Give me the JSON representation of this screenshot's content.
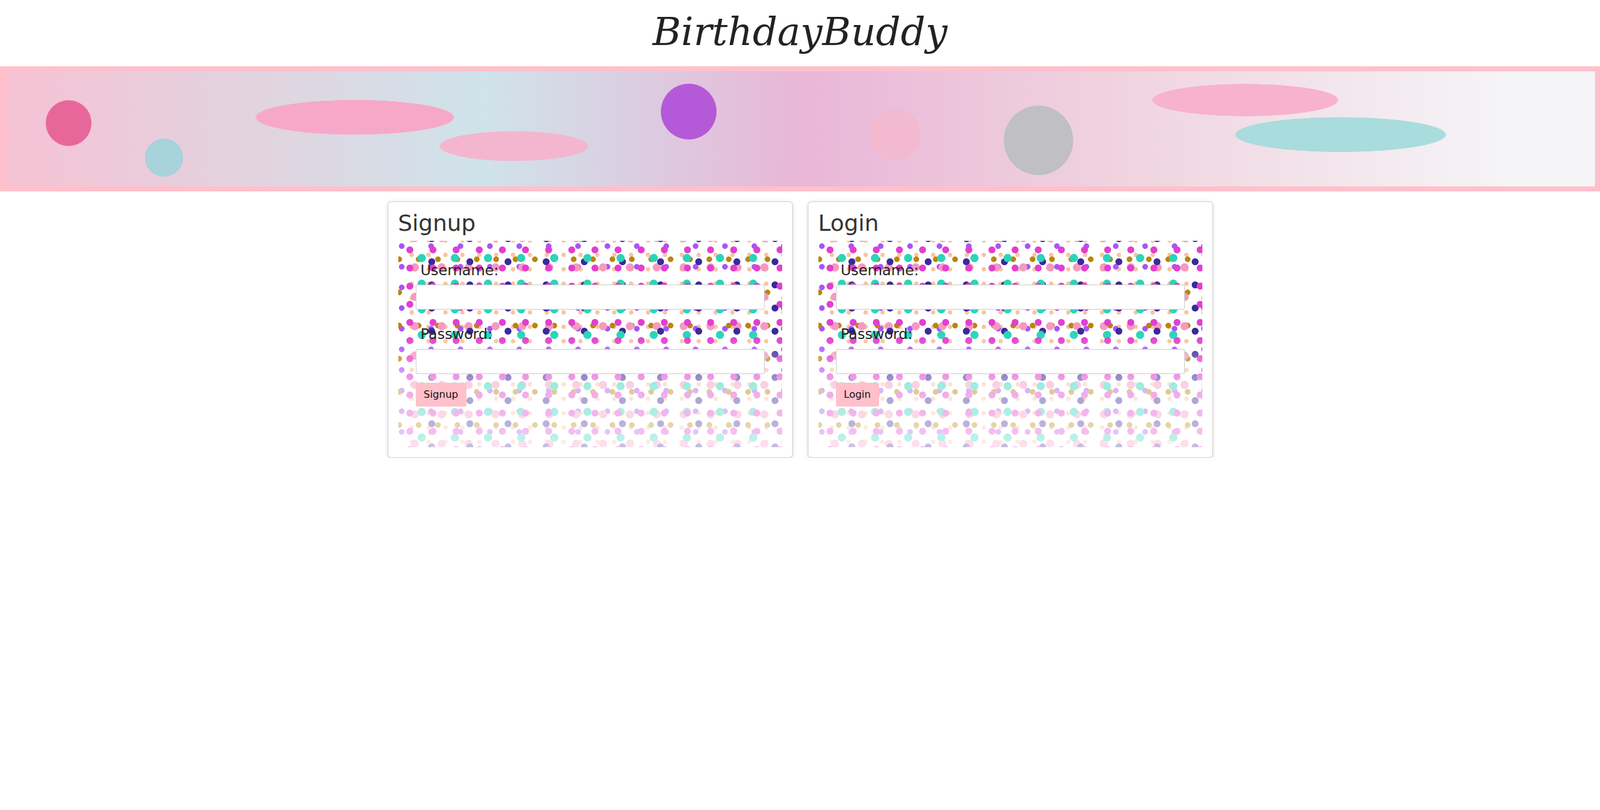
{
  "title": "BirthdayBuddy",
  "forms": [
    {
      "title": "Signup",
      "fields": [
        {
          "label": "Username:"
        },
        {
          "label": "Password:"
        }
      ],
      "button": "Signup"
    },
    {
      "title": "Login",
      "fields": [
        {
          "label": "Username:"
        },
        {
          "label": "Password:"
        }
      ],
      "button": "Login"
    }
  ]
}
